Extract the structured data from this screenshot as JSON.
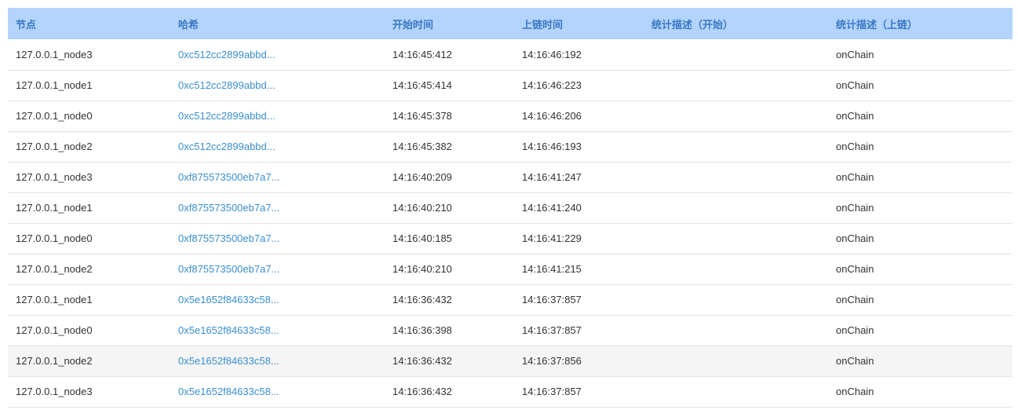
{
  "table": {
    "headers": {
      "node": "节点",
      "hash": "哈希",
      "start_time": "开始时间",
      "chain_time": "上链时间",
      "desc_start": "统计描述（开始）",
      "desc_chain": "统计描述（上链）"
    },
    "rows": [
      {
        "node": "127.0.0.1_node3",
        "hash": "0xc512cc2899abbd...",
        "start_time": "14:16:45:412",
        "chain_time": "14:16:46:192",
        "desc_start": "",
        "desc_chain": "onChain"
      },
      {
        "node": "127.0.0.1_node1",
        "hash": "0xc512cc2899abbd...",
        "start_time": "14:16:45:414",
        "chain_time": "14:16:46:223",
        "desc_start": "",
        "desc_chain": "onChain"
      },
      {
        "node": "127.0.0.1_node0",
        "hash": "0xc512cc2899abbd...",
        "start_time": "14:16:45:378",
        "chain_time": "14:16:46:206",
        "desc_start": "",
        "desc_chain": "onChain"
      },
      {
        "node": "127.0.0.1_node2",
        "hash": "0xc512cc2899abbd...",
        "start_time": "14:16:45:382",
        "chain_time": "14:16:46:193",
        "desc_start": "",
        "desc_chain": "onChain"
      },
      {
        "node": "127.0.0.1_node3",
        "hash": "0xf875573500eb7a7...",
        "start_time": "14:16:40:209",
        "chain_time": "14:16:41:247",
        "desc_start": "",
        "desc_chain": "onChain"
      },
      {
        "node": "127.0.0.1_node1",
        "hash": "0xf875573500eb7a7...",
        "start_time": "14:16:40:210",
        "chain_time": "14:16:41:240",
        "desc_start": "",
        "desc_chain": "onChain"
      },
      {
        "node": "127.0.0.1_node0",
        "hash": "0xf875573500eb7a7...",
        "start_time": "14:16:40:185",
        "chain_time": "14:16:41:229",
        "desc_start": "",
        "desc_chain": "onChain"
      },
      {
        "node": "127.0.0.1_node2",
        "hash": "0xf875573500eb7a7...",
        "start_time": "14:16:40:210",
        "chain_time": "14:16:41:215",
        "desc_start": "",
        "desc_chain": "onChain"
      },
      {
        "node": "127.0.0.1_node1",
        "hash": "0x5e1652f84633c58...",
        "start_time": "14:16:36:432",
        "chain_time": "14:16:37:857",
        "desc_start": "",
        "desc_chain": "onChain"
      },
      {
        "node": "127.0.0.1_node0",
        "hash": "0x5e1652f84633c58...",
        "start_time": "14:16:36:398",
        "chain_time": "14:16:37:857",
        "desc_start": "",
        "desc_chain": "onChain"
      },
      {
        "node": "127.0.0.1_node2",
        "hash": "0x5e1652f84633c58...",
        "start_time": "14:16:36:432",
        "chain_time": "14:16:37:856",
        "desc_start": "",
        "desc_chain": "onChain",
        "hovered": true
      },
      {
        "node": "127.0.0.1_node3",
        "hash": "0x5e1652f84633c58...",
        "start_time": "14:16:36:432",
        "chain_time": "14:16:37:857",
        "desc_start": "",
        "desc_chain": "onChain"
      }
    ]
  },
  "colors": {
    "header_bg": "#b3d4fc",
    "header_text": "#3a78c3",
    "link": "#3a8fd0",
    "row_hover": "#f5f5f5",
    "row_border": "#e3e3e3"
  }
}
